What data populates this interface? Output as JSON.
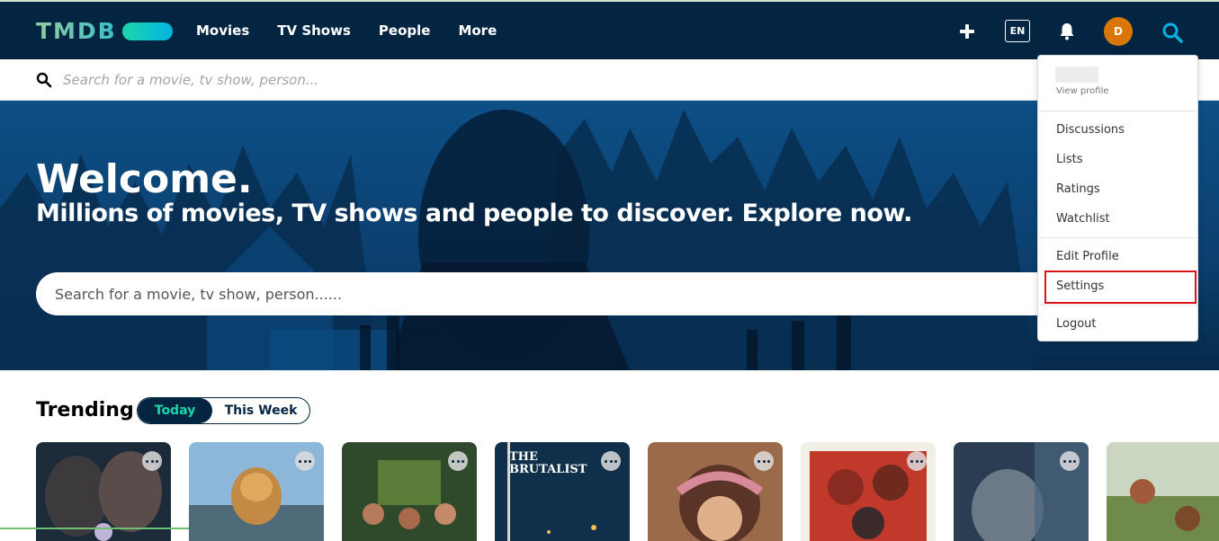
{
  "brand": {
    "logo_text": "TMDB"
  },
  "nav": {
    "links": [
      "Movies",
      "TV Shows",
      "People",
      "More"
    ],
    "language": "EN",
    "avatar_initial": "D"
  },
  "top_search": {
    "placeholder": "Search for a movie, tv show, person..."
  },
  "hero": {
    "title": "Welcome.",
    "subtitle": "Millions of movies, TV shows and people to discover. Explore now.",
    "search_placeholder": "Search for a movie, tv show, person......"
  },
  "trending": {
    "title": "Trending",
    "toggle_today": "Today",
    "toggle_week": "This Week",
    "posters": [
      {
        "label": ""
      },
      {
        "label": ""
      },
      {
        "label": ""
      },
      {
        "label": "THE BRUTALIST"
      },
      {
        "label": ""
      },
      {
        "label": ""
      },
      {
        "label": ""
      },
      {
        "label": ""
      }
    ]
  },
  "profile_menu": {
    "view_profile": "View profile",
    "items_group1": [
      "Discussions",
      "Lists",
      "Ratings",
      "Watchlist"
    ],
    "items_group2": [
      "Edit Profile",
      "Settings"
    ],
    "logout": "Logout",
    "highlighted": "Settings"
  },
  "colors": {
    "navbar": "#032541",
    "accent_green": "#1ed5a9",
    "accent_blue": "#01b4e4",
    "avatar": "#d97706",
    "highlight_box": "#d9151b"
  }
}
